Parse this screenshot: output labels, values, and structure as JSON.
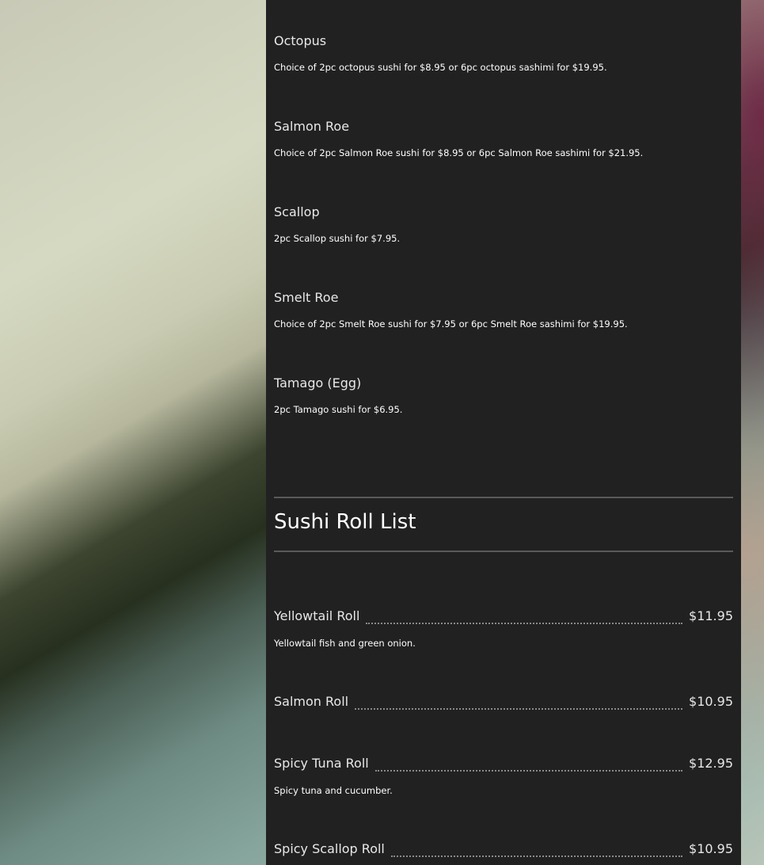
{
  "sushi_items": [
    {
      "title": "Octopus",
      "desc": "Choice of 2pc octopus sushi for $8.95 or 6pc octopus sashimi for $19.95."
    },
    {
      "title": "Salmon Roe",
      "desc": "Choice of 2pc Salmon Roe sushi for $8.95 or 6pc Salmon Roe sashimi for $21.95."
    },
    {
      "title": "Scallop",
      "desc": "2pc Scallop sushi for $7.95."
    },
    {
      "title": "Smelt Roe",
      "desc": "Choice of 2pc Smelt Roe sushi for $7.95 or 6pc Smelt Roe sashimi for $19.95."
    },
    {
      "title": "Tamago (Egg)",
      "desc": "2pc Tamago sushi for $6.95."
    }
  ],
  "roll_section": {
    "title": "Sushi Roll List"
  },
  "rolls": [
    {
      "name": "Yellowtail Roll",
      "price": "$11.95",
      "desc": "Yellowtail fish and green onion."
    },
    {
      "name": "Salmon Roll",
      "price": "$10.95",
      "desc": ""
    },
    {
      "name": "Spicy Tuna Roll",
      "price": "$12.95",
      "desc": "Spicy tuna and cucumber."
    },
    {
      "name": "Spicy Scallop Roll",
      "price": "$10.95",
      "desc": ""
    }
  ],
  "colors": {
    "panel_background": "#212121",
    "text": "#e8e8e8",
    "rule": "#5a5a5a"
  }
}
